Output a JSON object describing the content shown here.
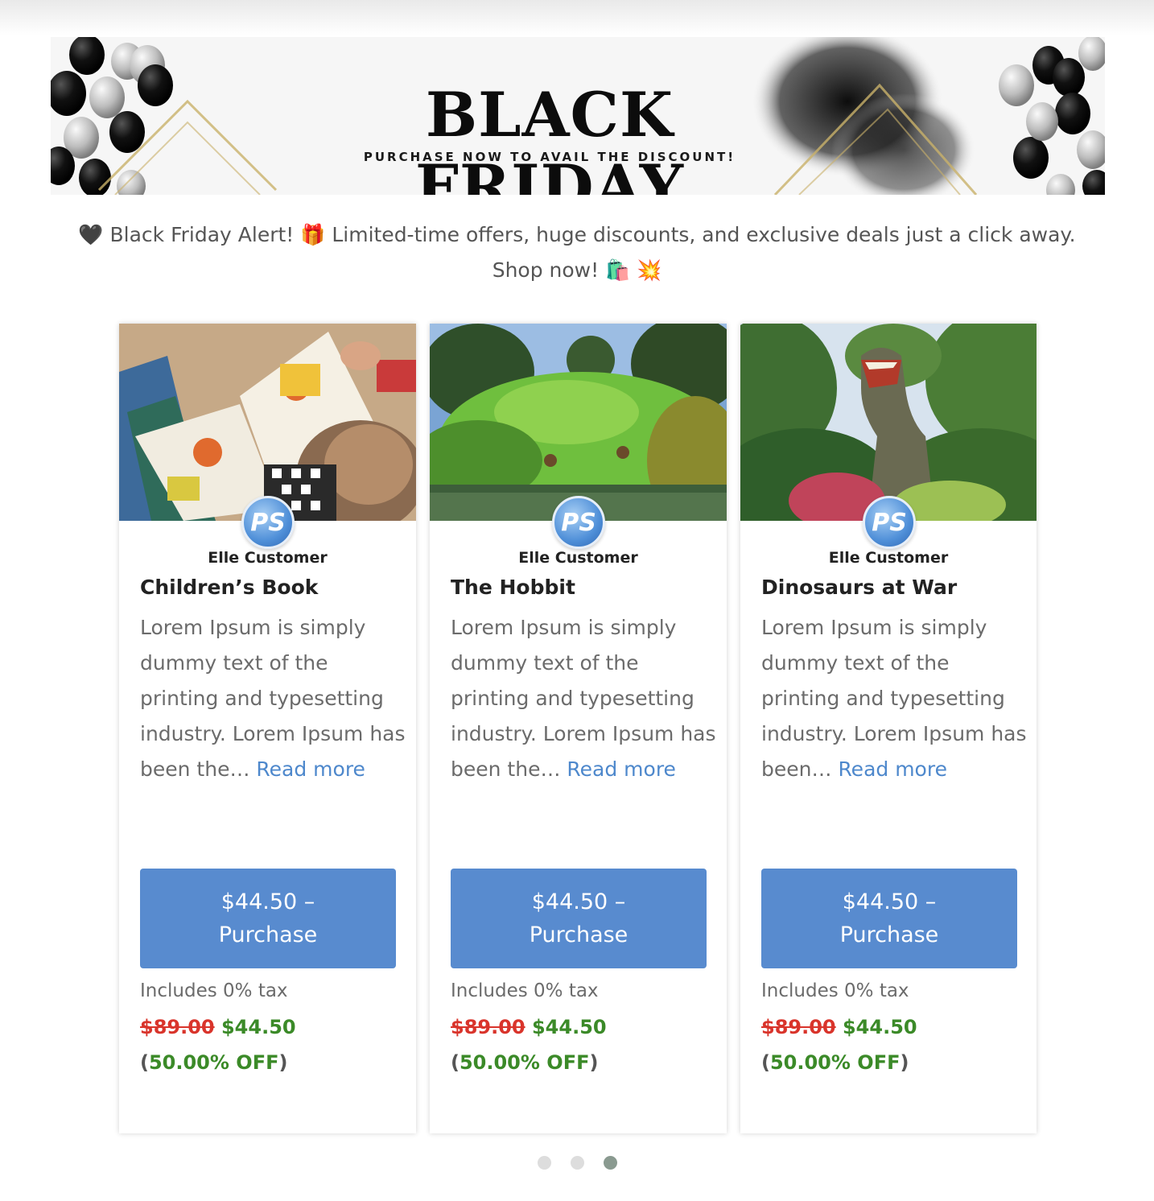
{
  "banner": {
    "title": "BLACK FRIDAY",
    "subtitle": "PURCHASE NOW TO AVAIL THE DISCOUNT!"
  },
  "alert": {
    "text": "🖤 Black Friday Alert! 🎁 Limited-time offers, huge discounts, and exclusive deals just a click away. Shop now! 🛍️ 💥"
  },
  "products": [
    {
      "image_icon": "children-reading-book-image",
      "avatar_text": "PS",
      "author": "Elle Customer",
      "title": "Children’s Book",
      "description": "Lorem Ipsum is simply dummy text of the printing and typesetting industry. Lorem Ipsum has been the…",
      "read_more": "Read more",
      "buy_price": "$44.50 –",
      "buy_label": "Purchase",
      "tax": "Includes 0% tax",
      "old_price": "$89.00",
      "new_price": "$44.50",
      "off_open": "(",
      "off": "50.00% OFF",
      "off_close": ")"
    },
    {
      "image_icon": "hobbit-hill-landscape-image",
      "avatar_text": "PS",
      "author": "Elle Customer",
      "title": "The Hobbit",
      "description": "Lorem Ipsum is simply dummy text of the printing and typesetting industry. Lorem Ipsum has been the…",
      "read_more": "Read more",
      "buy_price": "$44.50 –",
      "buy_label": "Purchase",
      "tax": "Includes 0% tax",
      "old_price": "$89.00",
      "new_price": "$44.50",
      "off_open": "(",
      "off": "50.00% OFF",
      "off_close": ")"
    },
    {
      "image_icon": "dinosaur-statue-image",
      "avatar_text": "PS",
      "author": "Elle Customer",
      "title": "Dinosaurs at War",
      "description": "Lorem Ipsum is simply dummy text of the printing and typesetting industry. Lorem Ipsum has been…",
      "read_more": "Read more",
      "buy_price": "$44.50 –",
      "buy_label": "Purchase",
      "tax": "Includes 0% tax",
      "old_price": "$89.00",
      "new_price": "$44.50",
      "off_open": "(",
      "off": "50.00% OFF",
      "off_close": ")"
    }
  ],
  "carousel": {
    "pages": 3,
    "active": 3
  },
  "colors": {
    "button": "#588bcf",
    "link": "#4e88cc",
    "old_price": "#d9342b",
    "sale_price": "#3b8a28"
  }
}
